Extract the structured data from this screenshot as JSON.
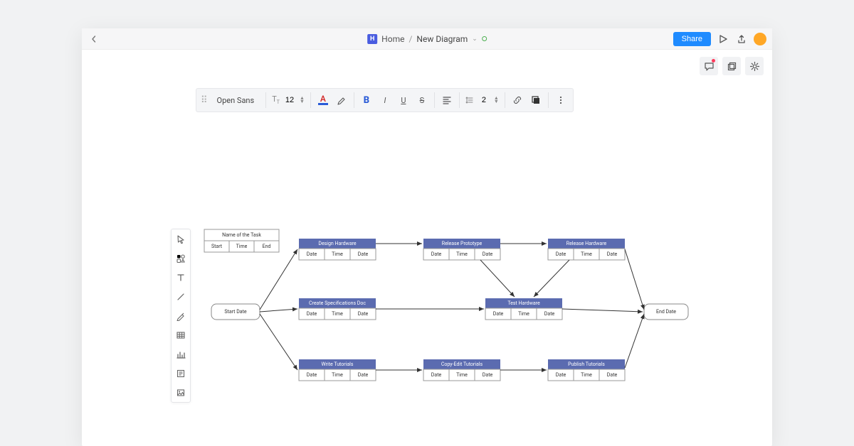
{
  "header": {
    "logo_letter": "H",
    "home": "Home",
    "sep": "/",
    "doc": "New Diagram",
    "share": "Share"
  },
  "toolbar": {
    "font": "Open Sans",
    "size": "12",
    "spacing": "2"
  },
  "legend": {
    "title": "Name of the Task",
    "c1": "Start",
    "c2": "Time",
    "c3": "End"
  },
  "start": "Start Date",
  "end": "End Date",
  "cell": {
    "c1": "Date",
    "c2": "Time",
    "c3": "Date"
  },
  "tasks": {
    "design": "Design Hardware",
    "release": "Release Prototype",
    "relhw": "Release Hardware",
    "spec": "Create Specifications Doc",
    "testhw": "Test Hardware",
    "write": "Write Tutorials",
    "copy": "Copy-Edit Tutorials",
    "pub": "Publish Tutorials"
  }
}
